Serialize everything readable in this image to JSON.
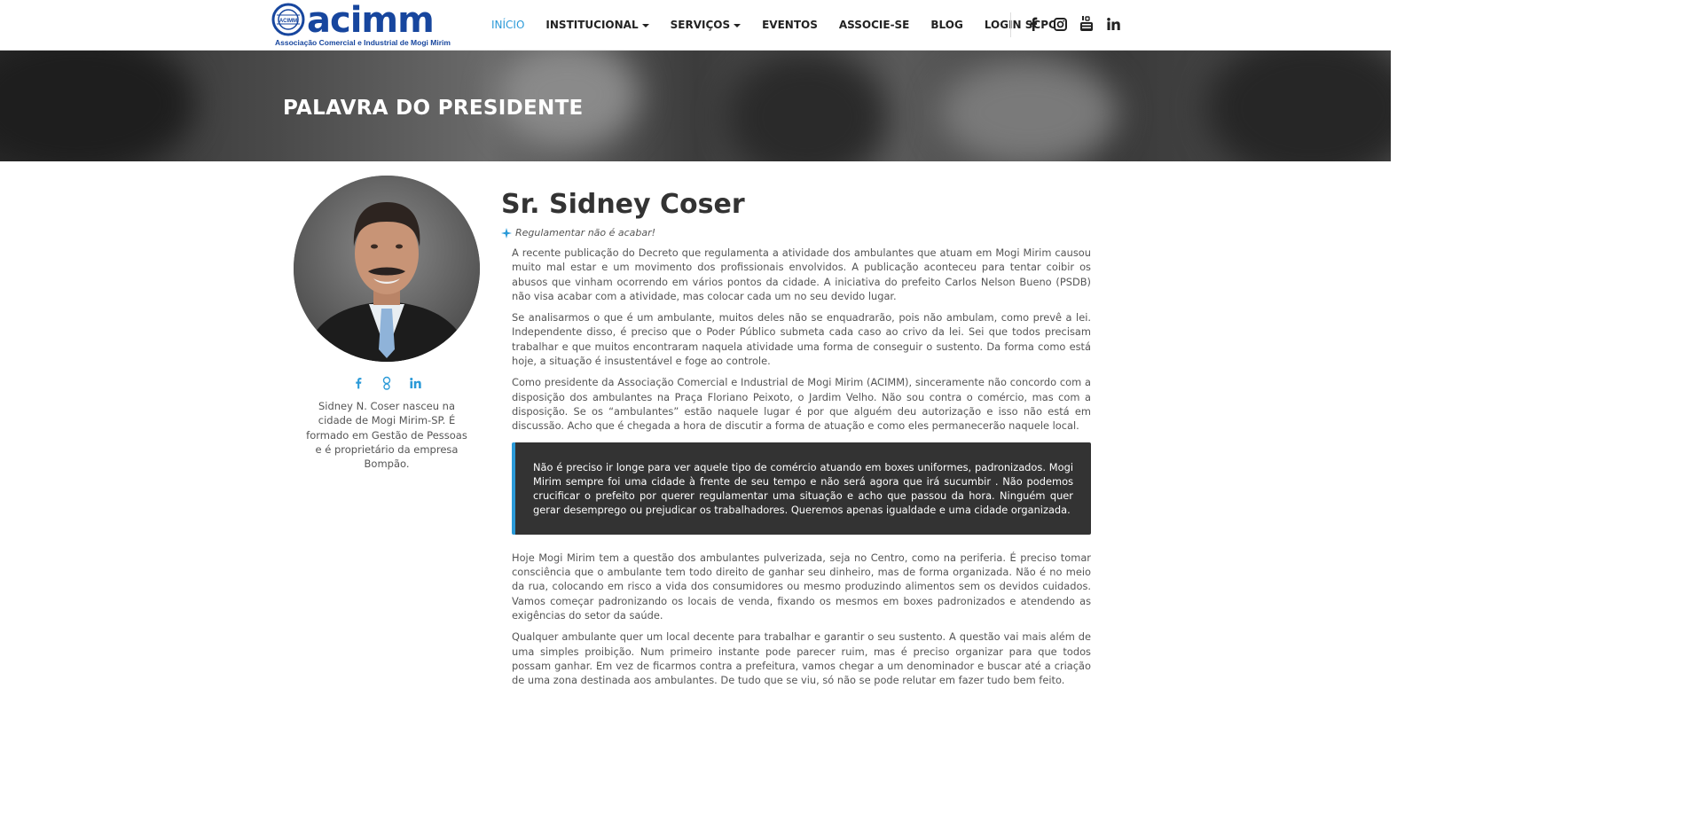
{
  "header": {
    "logo_word": "acimm",
    "logo_subtitle": "Associação Comercial e Industrial de Mogi Mirim",
    "logo_badge": "ACIMM",
    "nav": [
      {
        "label": "INÍCIO",
        "active": true,
        "dropdown": false
      },
      {
        "label": "INSTITUCIONAL",
        "active": false,
        "dropdown": true
      },
      {
        "label": "SERVIÇOS",
        "active": false,
        "dropdown": true
      },
      {
        "label": "EVENTOS",
        "active": false,
        "dropdown": false
      },
      {
        "label": "ASSOCIE-SE",
        "active": false,
        "dropdown": false
      },
      {
        "label": "BLOG",
        "active": false,
        "dropdown": false
      },
      {
        "label": "LOGIN SCPC",
        "active": false,
        "dropdown": false
      }
    ],
    "social_icons": [
      "facebook-icon",
      "instagram-icon",
      "youtube-icon",
      "linkedin-icon"
    ]
  },
  "banner": {
    "title": "PALAVRA DO PRESIDENTE"
  },
  "profile": {
    "social_icons": [
      "facebook-icon",
      "google-plus-icon",
      "linkedin-icon"
    ],
    "bio": "Sidney N. Coser nasceu na cidade de Mogi Mirim-SP. É formado em Gestão de Pessoas e é proprietário da empresa Bompão."
  },
  "article": {
    "name": "Sr. Sidney Coser",
    "tagline": "Regulamentar não é acabar!",
    "paragraphs_before": [
      "A recente publicação do Decreto que regulamenta a atividade dos ambulantes que atuam em Mogi Mirim causou muito mal estar e um movimento dos profissionais envolvidos. A publicação aconteceu para tentar coibir os abusos que vinham ocorrendo em vários pontos da cidade. A iniciativa do prefeito Carlos Nelson Bueno (PSDB) não visa acabar com a atividade, mas colocar cada um no seu devido lugar.",
      "Se analisarmos o que é um ambulante, muitos deles não se enquadrarão, pois não ambulam, como prevê a lei. Independente disso, é preciso que o Poder Público submeta cada caso ao crivo da lei. Sei que todos precisam trabalhar e que muitos encontraram naquela atividade uma forma de conseguir o sustento. Da forma como está hoje, a situação é insustentável e foge ao controle.",
      "Como presidente da Associação Comercial e Industrial de Mogi Mirim (ACIMM), sinceramente não concordo com a disposição dos ambulantes na Praça Floriano Peixoto, o Jardim Velho. Não sou contra o comércio, mas com a disposição. Se os “ambulantes” estão naquele lugar é por que alguém deu autorização e isso não está em discussão. Acho que é chegada a hora de discutir a forma de atuação e como eles permanecerão naquele local."
    ],
    "quote": "Não é preciso ir longe para ver aquele tipo de comércio atuando em boxes uniformes, padronizados. Mogi Mirim sempre foi uma cidade à frente de seu tempo e não será agora que irá sucumbir . Não podemos crucificar o prefeito por querer regulamentar uma situação e acho que passou da hora. Ninguém quer gerar desemprego ou prejudicar os trabalhadores. Queremos apenas igualdade e uma cidade organizada.",
    "paragraphs_after": [
      "Hoje Mogi Mirim tem a questão dos ambulantes pulverizada, seja no Centro, como na periferia. É preciso tomar consciência que o ambulante tem todo direito de ganhar seu dinheiro, mas de forma organizada. Não é no meio da rua, colocando em risco a vida dos consumidores ou mesmo produzindo alimentos sem os devidos cuidados. Vamos começar padronizando os locais de venda, fixando os mesmos em boxes padronizados e atendendo as exigências do setor da saúde.",
      "Qualquer ambulante quer um local decente para trabalhar e garantir o seu sustento. A questão vai mais além de uma simples proibição. Num primeiro instante pode parecer ruim, mas é preciso organizar para que todos possam ganhar. Em vez de ficarmos contra a prefeitura, vamos chegar a um denominador e buscar até a criação de uma zona destinada aos ambulantes. De tudo que se viu, só não se pode relutar em fazer tudo bem feito."
    ]
  },
  "colors": {
    "brand_blue": "#17469e",
    "accent_blue": "#2b9ad8",
    "quote_bg": "#333333",
    "nav_text": "#222222"
  }
}
